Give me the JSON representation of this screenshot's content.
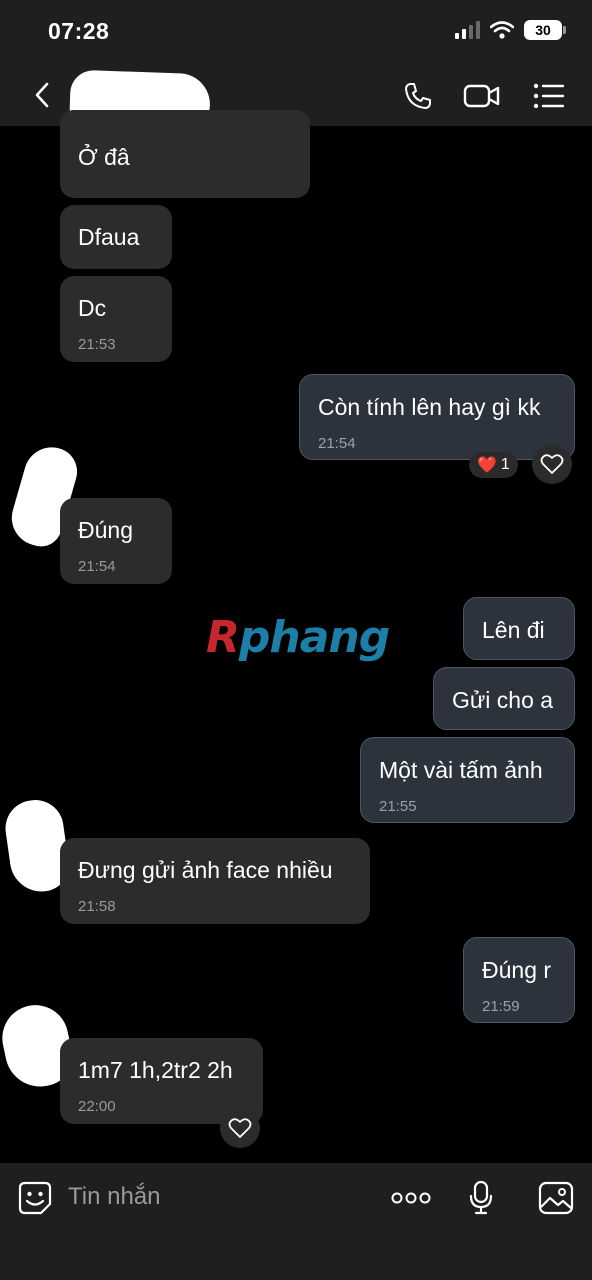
{
  "status_bar": {
    "time": "07:28",
    "battery": "30"
  },
  "header": {
    "icons": [
      "back-chevron-icon",
      "phone-icon",
      "video-call-icon",
      "menu-list-icon"
    ]
  },
  "messages": [
    {
      "dir": "in",
      "text": "Ở đâ",
      "time": ""
    },
    {
      "dir": "in",
      "text": "Dfaua",
      "time": ""
    },
    {
      "dir": "in",
      "text": "Dc",
      "time": "21:53"
    },
    {
      "dir": "out",
      "text": "Còn tính lên hay gì kk",
      "time": "21:54"
    },
    {
      "dir": "in",
      "text": "Đúng",
      "time": "21:54"
    },
    {
      "dir": "out",
      "text": "Lên đi",
      "time": ""
    },
    {
      "dir": "out",
      "text": "Gửi cho a",
      "time": ""
    },
    {
      "dir": "out",
      "text": "Một vài tấm ảnh",
      "time": "21:55"
    },
    {
      "dir": "in",
      "text": "Đưng gửi ảnh face nhiều",
      "time": "21:58"
    },
    {
      "dir": "out",
      "text": "Đúng r",
      "time": "21:59"
    },
    {
      "dir": "in",
      "text": "1m7 1h,2tr2 2h",
      "time": "22:00"
    }
  ],
  "reaction": {
    "emoji": "❤️",
    "count": "1"
  },
  "watermark": {
    "first": "R",
    "rest": "phang"
  },
  "composer": {
    "placeholder": "Tin nhắn"
  },
  "colors": {
    "bar_bg": "#1f1f1f",
    "incoming_bubble": "#2c2c2e",
    "outgoing_bubble": "#2c333d",
    "outgoing_border": "#4d5663"
  }
}
